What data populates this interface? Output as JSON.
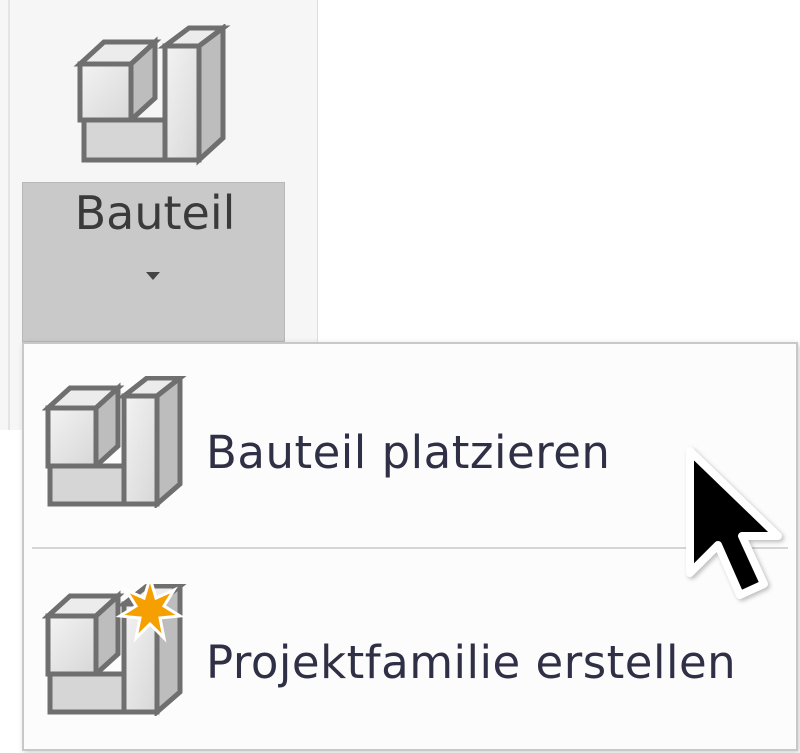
{
  "ribbon": {
    "button_label": "Bauteil",
    "large_icon": "component-block-icon",
    "caret_icon": "chevron-down-icon"
  },
  "dropdown": {
    "items": [
      {
        "label": "Bauteil platzieren",
        "icon": "component-block-icon"
      },
      {
        "label": "Projektfamilie erstellen",
        "icon": "component-block-star-icon"
      }
    ]
  },
  "colors": {
    "ribbon_button_bg": "#c9c9c9",
    "menu_bg": "#fcfcfc",
    "menu_text": "#2f3046",
    "star": "#f5a000"
  },
  "cursor": "arrow-pointer-icon"
}
